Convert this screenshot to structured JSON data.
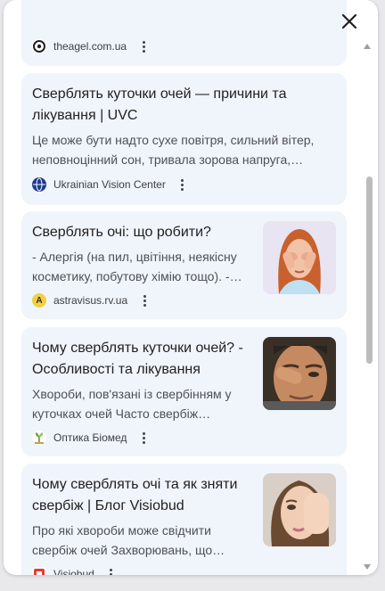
{
  "close_label": "Close",
  "results": [
    {
      "title": "",
      "snippet": "",
      "source": "theagel.com.ua",
      "favicon": "eye-circle-icon",
      "has_image": false
    },
    {
      "title": "Сверблять куточки очей — причини та лікування | UVC",
      "snippet": "Це може бути надто сухе повітря, сильний вітер, неповноцінний сон, тривала зорова напруга,…",
      "source": "Ukrainian Vision Center",
      "favicon": "uvc-globe-icon",
      "has_image": false
    },
    {
      "title": "Сверблять очі: що робити?",
      "snippet": "- Алергія (на пил, цвітіння, неякісну косметику, побутову хімію тощо). -…",
      "source": "astravisus.rv.ua",
      "favicon": "astravisus-a-icon",
      "has_image": true,
      "image_name": "girl-rubbing-eyes-image"
    },
    {
      "title": "Чому сверблять куточки очей? - Особливості та лікування",
      "snippet": "Хвороби, пов'язані із свербінням у куточках очей Часто свербіж…",
      "source": "Оптика Біомед",
      "favicon": "biomed-leaf-icon",
      "has_image": true,
      "image_name": "man-rubbing-eye-image"
    },
    {
      "title": "Чому сверблять очі та як зняти свербіж | Блог Visiobud",
      "snippet": "Про які хвороби може свідчити свербіж очей Захворювань, що…",
      "source": "Visiobud",
      "favicon": "visiobud-icon",
      "has_image": true,
      "image_name": "woman-covering-eye-image"
    }
  ],
  "colors": {
    "card_bg": "#f0f4fb",
    "title": "#1f1f1f",
    "snippet": "#4d5156"
  }
}
